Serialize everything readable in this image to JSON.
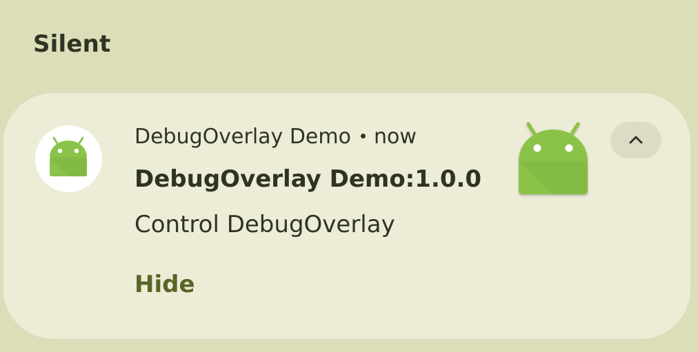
{
  "section": {
    "header": "Silent"
  },
  "notification": {
    "app_name": "DebugOverlay Demo",
    "separator_icon": "dot-separator",
    "timestamp": "now",
    "title": "DebugOverlay Demo:1.0.0",
    "body": "Control DebugOverlay",
    "action_label": "Hide",
    "small_icon": "android-robot-icon",
    "large_icon": "android-robot-icon",
    "expand_icon": "chevron-up-icon"
  },
  "colors": {
    "background": "#dcddb9",
    "card": "#ececd7",
    "text": "#2f3322",
    "action": "#5a6426",
    "android_green": "#8bc34a",
    "expand_button": "#dcdcc6"
  }
}
